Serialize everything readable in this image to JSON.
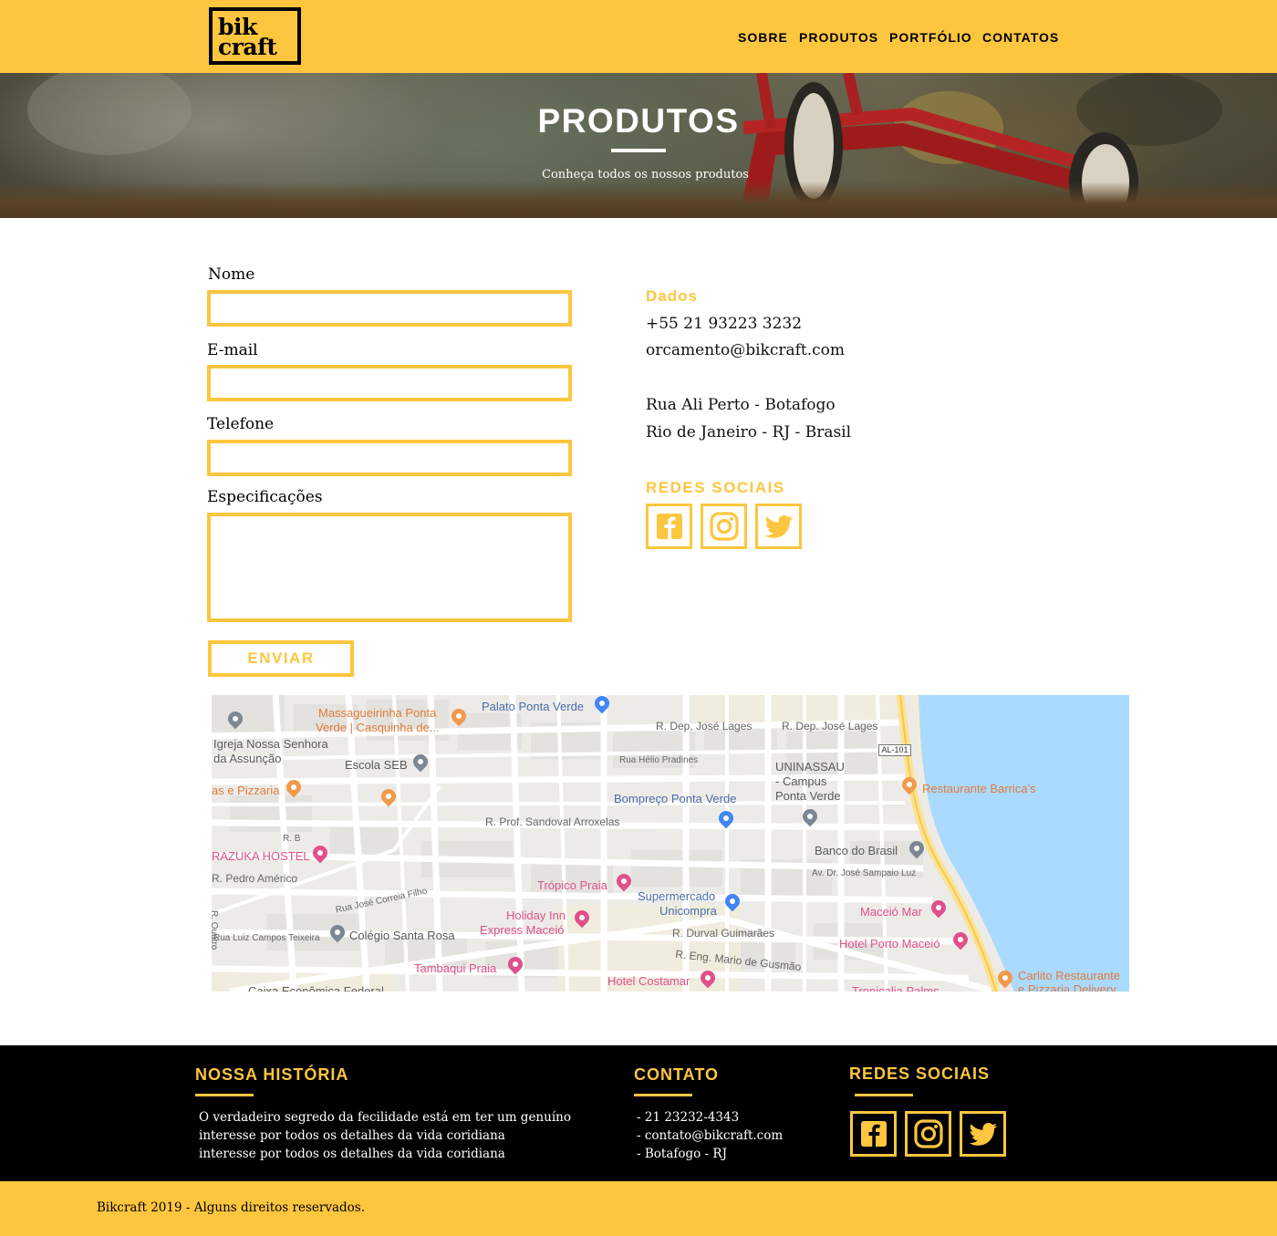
{
  "brand": {
    "logo_line1": "bik",
    "logo_line2": "craft"
  },
  "nav": {
    "items": [
      "SOBRE",
      "PRODUTOS",
      "PORTFÓLIO",
      "CONTATOS"
    ]
  },
  "hero": {
    "title": "PRODUTOS",
    "subtitle": "Conheça todos os nossos produtos"
  },
  "form": {
    "fields": [
      {
        "label": "Nome",
        "value": ""
      },
      {
        "label": "E-mail",
        "value": ""
      },
      {
        "label": "Telefone",
        "value": ""
      },
      {
        "label": "Especificações",
        "value": ""
      }
    ],
    "submit_label": "ENVIAR"
  },
  "contact": {
    "heading": "Dados",
    "phone": "+55 21 93223 3232",
    "email": "orcamento@bikcraft.com",
    "address1": "Rua Ali Perto - Botafogo",
    "address2": "Rio de Janeiro - RJ - Brasil",
    "social_heading": "REDES SOCIAIS"
  },
  "social_icons": [
    "facebook-icon",
    "instagram-icon",
    "twitter-icon"
  ],
  "map": {
    "pois": [
      "Massagueirinha Ponta",
      "Verde | Casquinha de...",
      "Palato Ponta Verde",
      "Igreja Nossa Senhora",
      "da Assunção",
      "Escola SEB",
      "UNINASSAU",
      "- Campus",
      "Ponta Verde",
      "Restaurante Barrica's",
      "as e Pizzaria",
      "Bompreço Ponta Verde",
      "RAZUKA HOSTEL",
      "Banco do Brasil",
      "Trópico Praia",
      "Supermercado",
      "Unicompra",
      "Maceió Mar",
      "Holiday Inn",
      "Express Maceió",
      "Colégio Santa Rosa",
      "Hotel Porto Maceió",
      "Tambaqui Praia",
      "Hotel Costamar",
      "Carlito Restaurante",
      "e Pizzaria Delivery",
      "Tropicalia Palms",
      "Caixa Econômica Federal"
    ],
    "streets": [
      "R. Dep. José Lages",
      "R. Dep. José Lages",
      "Rua Hélio Pradines",
      "R. Prof. Sandoval Arroxelas",
      "R. B",
      "R. Pedro Américo",
      "Av. Dr. José Sampaio Luz",
      "Rua José Correia Filho",
      "R. Quatro",
      "Rua Luiz Campos Teixeira",
      "R. Durval Guimarães",
      "R. Eng. Mario de Gusmão"
    ],
    "route_badge": "AL-101"
  },
  "footer": {
    "history_heading": "NOSSA HISTÓRIA",
    "history_lines": [
      "O verdadeiro segredo da fecilidade está em ter um genuíno",
      "interesse por todos os detalhes da vida coridiana",
      "interesse por todos os detalhes da vida coridiana"
    ],
    "contact_heading": "CONTATO",
    "contact_lines": [
      "- 21 23232-4343",
      "- contato@bikcraft.com",
      "- Botafogo - RJ"
    ],
    "social_heading": "REDES SOCIAIS",
    "copyright": "Bikcraft 2019 - Alguns direitos reservados."
  },
  "colors": {
    "accent": "#FEC63F",
    "footer_bg": "#000000",
    "water": "#aadaff"
  }
}
